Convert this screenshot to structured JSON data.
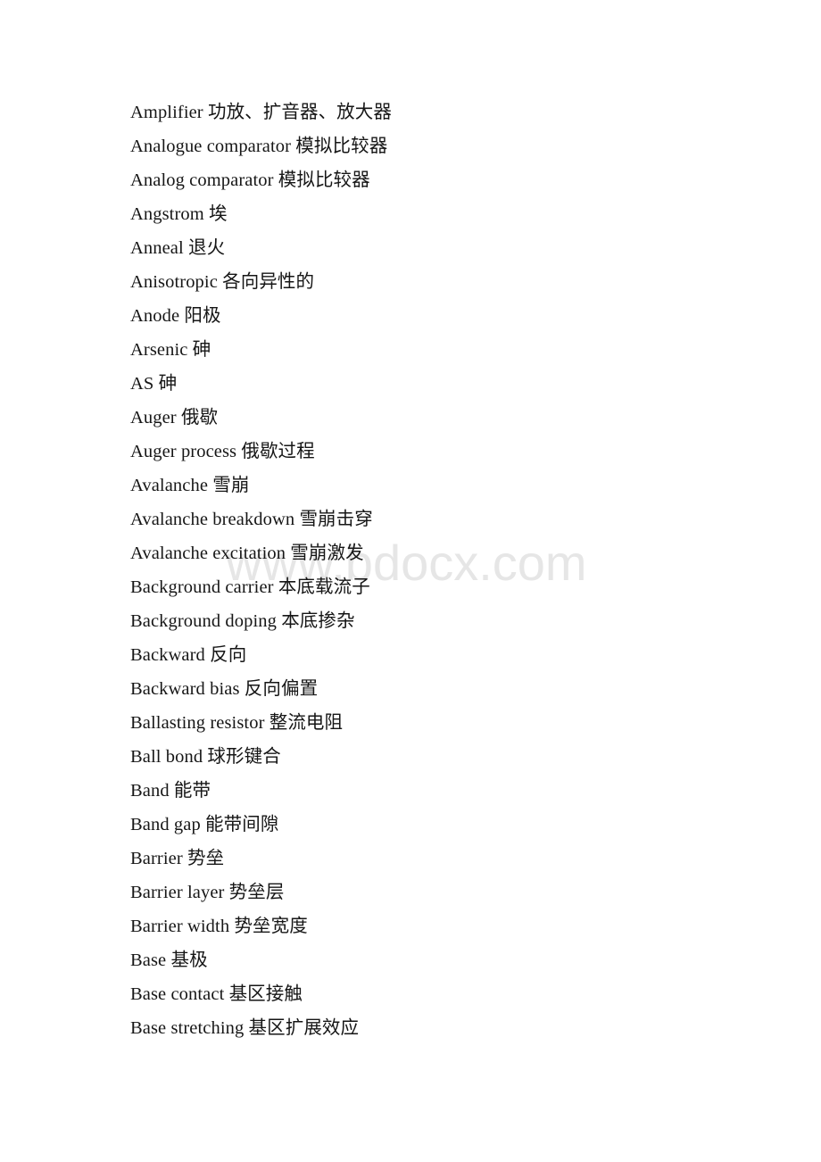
{
  "page": {
    "background_color": "#ffffff",
    "text_color": "#161616"
  },
  "watermark": {
    "text": "www.bdocx.com",
    "color": "#e6e6e6"
  },
  "glossary": {
    "entries": [
      {
        "term": "Amplifier",
        "translation": "功放、扩音器、放大器",
        "line": "Amplifier 功放、扩音器、放大器"
      },
      {
        "term": "Analogue comparator",
        "translation": "模拟比较器",
        "line": "Analogue comparator 模拟比较器"
      },
      {
        "term": "Analog comparator",
        "translation": "模拟比较器",
        "line": "Analog comparator 模拟比较器"
      },
      {
        "term": "Angstrom",
        "translation": "埃",
        "line": "Angstrom 埃"
      },
      {
        "term": "Anneal",
        "translation": "退火",
        "line": "Anneal 退火"
      },
      {
        "term": "Anisotropic",
        "translation": "各向异性的",
        "line": "Anisotropic 各向异性的"
      },
      {
        "term": "Anode",
        "translation": "阳极",
        "line": "Anode 阳极"
      },
      {
        "term": "Arsenic",
        "translation": "砷",
        "line": "Arsenic 砷"
      },
      {
        "term": "AS",
        "translation": "砷",
        "line": "AS 砷"
      },
      {
        "term": "Auger",
        "translation": "俄歇",
        "line": "Auger 俄歇"
      },
      {
        "term": "Auger process",
        "translation": "俄歇过程",
        "line": "Auger process 俄歇过程"
      },
      {
        "term": "Avalanche",
        "translation": "雪崩",
        "line": "Avalanche 雪崩"
      },
      {
        "term": "Avalanche breakdown",
        "translation": "雪崩击穿",
        "line": "Avalanche breakdown 雪崩击穿"
      },
      {
        "term": "Avalanche excitation",
        "translation": "雪崩激发",
        "line": "Avalanche excitation 雪崩激发"
      },
      {
        "term": "Background carrier",
        "translation": "本底载流子",
        "line": "Background carrier 本底载流子"
      },
      {
        "term": "Background doping",
        "translation": "本底掺杂",
        "line": "Background doping 本底掺杂"
      },
      {
        "term": "Backward",
        "translation": "反向",
        "line": "Backward 反向"
      },
      {
        "term": "Backward bias",
        "translation": "反向偏置",
        "line": "Backward bias 反向偏置"
      },
      {
        "term": "Ballasting resistor",
        "translation": "整流电阻",
        "line": "Ballasting resistor 整流电阻"
      },
      {
        "term": "Ball bond",
        "translation": "球形键合",
        "line": "Ball bond 球形键合"
      },
      {
        "term": "Band",
        "translation": "能带",
        "line": "Band 能带"
      },
      {
        "term": "Band gap",
        "translation": "能带间隙",
        "line": "Band gap 能带间隙"
      },
      {
        "term": "Barrier",
        "translation": "势垒",
        "line": "Barrier 势垒"
      },
      {
        "term": "Barrier layer",
        "translation": "势垒层",
        "line": "Barrier layer 势垒层"
      },
      {
        "term": "Barrier width",
        "translation": "势垒宽度",
        "line": "Barrier width 势垒宽度"
      },
      {
        "term": "Base",
        "translation": "基极",
        "line": "Base 基极"
      },
      {
        "term": "Base contact",
        "translation": "基区接触",
        "line": "Base contact 基区接触"
      },
      {
        "term": "Base stretching",
        "translation": "基区扩展效应",
        "line": "Base stretching 基区扩展效应"
      }
    ]
  }
}
